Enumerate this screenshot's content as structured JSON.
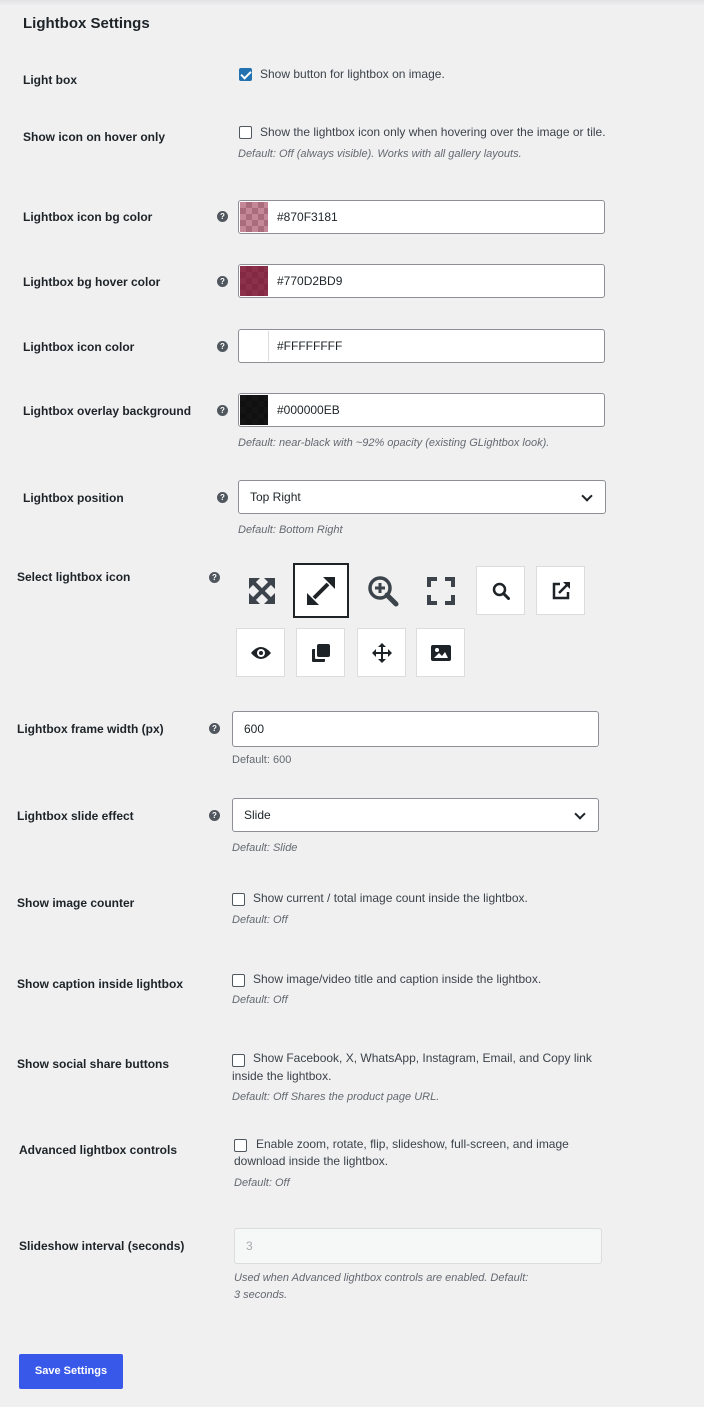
{
  "section_title": "Lightbox Settings",
  "light_box": {
    "label": "Light box",
    "checked": true,
    "text": "Show button for lightbox on image."
  },
  "hover_only": {
    "label": "Show icon on hover only",
    "checked": false,
    "text": "Show the lightbox icon only when hovering over the image or tile.",
    "note": "Default: Off (always visible). Works with all gallery layouts."
  },
  "icon_bg_color": {
    "label": "Lightbox icon bg color",
    "value": "#870F3181",
    "swatch": "#870F3181"
  },
  "bg_hover_color": {
    "label": "Lightbox bg hover color",
    "value": "#770D2BD9",
    "swatch": "#770D2BD9"
  },
  "icon_color": {
    "label": "Lightbox icon color",
    "value": "#FFFFFFFF",
    "swatch": "#FFFFFFFF"
  },
  "overlay_bg": {
    "label": "Lightbox overlay background",
    "value": "#000000EB",
    "swatch": "#000000EB",
    "note": "Default: near-black with ~92% opacity (existing GLightbox look)."
  },
  "position": {
    "label": "Lightbox position",
    "value": "Top Right",
    "note": "Default: Bottom Right"
  },
  "icon_select": {
    "label": "Select lightbox icon",
    "icons": [
      "expand-arrows-icon",
      "diagonal-expand-icon",
      "zoom-in-icon",
      "fullscreen-corners-icon",
      "search-icon",
      "external-link-icon",
      "eye-icon",
      "clone-icon",
      "move-arrows-icon",
      "image-icon"
    ],
    "selected": "diagonal-expand-icon"
  },
  "frame_width": {
    "label": "Lightbox frame width (px)",
    "value": "600",
    "note": "Default: 600"
  },
  "slide_effect": {
    "label": "Lightbox slide effect",
    "value": "Slide",
    "note": "Default: Slide"
  },
  "image_counter": {
    "label": "Show image counter",
    "checked": false,
    "text": "Show current / total image count inside the lightbox.",
    "note": "Default: Off"
  },
  "caption": {
    "label": "Show caption inside lightbox",
    "checked": false,
    "text": "Show image/video title and caption inside the lightbox.",
    "note": "Default: Off"
  },
  "social_share": {
    "label": "Show social share buttons",
    "checked": false,
    "text_line1": "Show Facebook, X, WhatsApp, Instagram, Email, and Copy link",
    "text_line2": "inside the lightbox.",
    "note": "Default: Off Shares the product page URL."
  },
  "advanced": {
    "label": "Advanced lightbox controls",
    "checked": false,
    "text_line1": "Enable zoom, rotate, flip, slideshow, full-screen, and image",
    "text_line2": "download inside the lightbox.",
    "note": "Default: Off"
  },
  "slideshow_interval": {
    "label": "Slideshow interval (seconds)",
    "value": "3",
    "note_line1": "Used when Advanced lightbox controls are enabled. Default:",
    "note_line2": "3 seconds."
  },
  "save_button": "Save Settings",
  "help_glyph": "?",
  "colors": {
    "accent": "#3858e9",
    "checkbox": "#2271b1",
    "background": "#f0f0f1"
  }
}
